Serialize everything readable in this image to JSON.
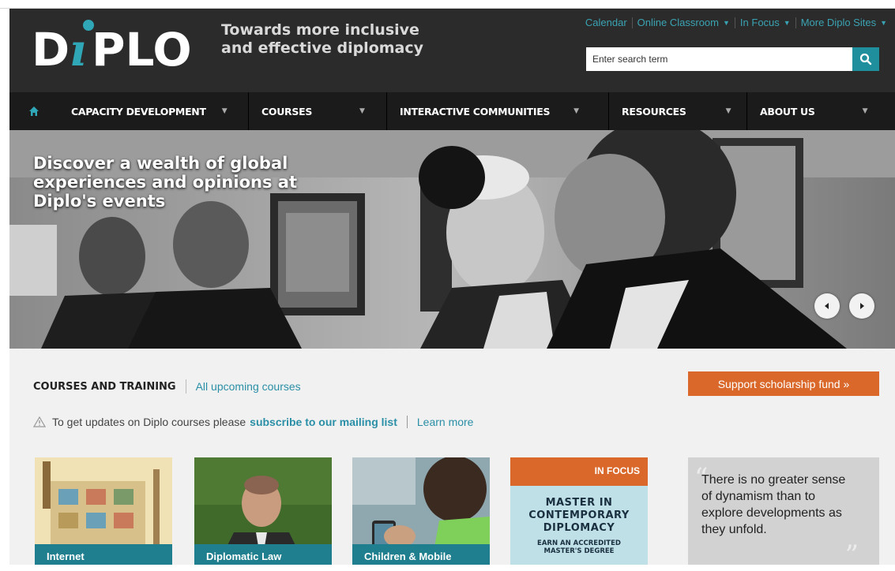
{
  "brand": {
    "logo_text": "DiPLO",
    "tagline_line1": "Towards more inclusive",
    "tagline_line2": "and effective diplomacy"
  },
  "top_links": [
    {
      "label": "Calendar",
      "dropdown": false
    },
    {
      "label": "Online Classroom",
      "dropdown": true
    },
    {
      "label": "In Focus",
      "dropdown": true
    },
    {
      "label": "More Diplo Sites",
      "dropdown": true
    }
  ],
  "search": {
    "placeholder": "Enter search term",
    "icon": "search-icon"
  },
  "nav": {
    "home_icon": "home-icon",
    "items": [
      {
        "label": "CAPACITY DEVELOPMENT"
      },
      {
        "label": "COURSES"
      },
      {
        "label": "INTERACTIVE COMMUNITIES"
      },
      {
        "label": "RESOURCES"
      },
      {
        "label": "ABOUT US"
      }
    ]
  },
  "hero": {
    "caption_line1": "Discover a wealth of global",
    "caption_line2": "experiences and opinions at",
    "caption_line3": "Diplo's events",
    "prev_icon": "chevron-left-icon",
    "next_icon": "chevron-right-icon"
  },
  "courses": {
    "title": "COURSES AND TRAINING",
    "all_link": "All upcoming courses",
    "support_button": "Support scholarship fund  »",
    "notice_text": "To get updates on Diplo courses please",
    "notice_link": "subscribe to our mailing list",
    "learn_more": "Learn more",
    "cards": [
      {
        "label": "Internet"
      },
      {
        "label": "Diplomatic Law"
      },
      {
        "label": "Children & Mobile"
      }
    ],
    "in_focus": {
      "tag": "IN FOCUS",
      "line1": "MASTER IN",
      "line2": "CONTEMPORARY",
      "line3": "DIPLOMACY",
      "line4": "EARN AN ACCREDITED",
      "line5": "MASTER'S DEGREE"
    },
    "quote": "There is no greater sense of dynamism than to explore developments as they unfold."
  },
  "colors": {
    "header_bg": "#2b2b2b",
    "nav_bg": "#1b1b1b",
    "teal": "#1f8f9e",
    "orange": "#d9682a",
    "link": "#2a8fa6"
  }
}
